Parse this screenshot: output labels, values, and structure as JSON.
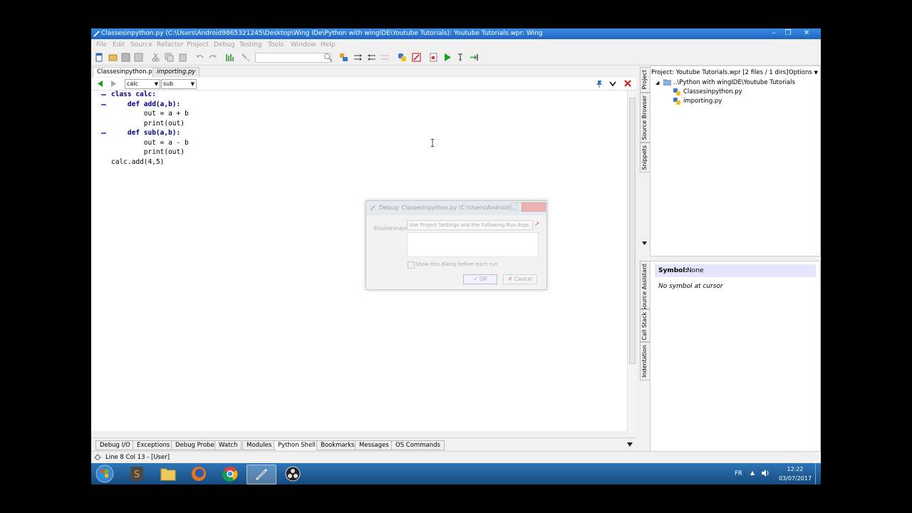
{
  "window": {
    "title": "Classesinpython.py (C:\\Users\\Android9865321245\\Desktop\\Wing IDe\\Python with wingIDE\\Youtube Tutorials): Youtube Tutorials.wpr: Wing"
  },
  "menu": [
    "File",
    "Edit",
    "Source",
    "Refactor",
    "Project",
    "Debug",
    "Testing",
    "Tools",
    "Window",
    "Help"
  ],
  "file_tabs": [
    {
      "label": "Classesinpython.py",
      "active": true
    },
    {
      "label": "importing.py",
      "active": false
    }
  ],
  "editor_bar": {
    "scope1": "calc",
    "scope2": "sub"
  },
  "code_lines": [
    "class calc:",
    "    def add(a,b):",
    "        out = a + b",
    "        print(out)",
    "    def sub(a,b):",
    "        out = a - b",
    "        print(out)",
    "calc.add(4,5)"
  ],
  "bottom_tabs": [
    {
      "label": "Debug I/O",
      "active": false
    },
    {
      "label": "Exceptions",
      "active": false
    },
    {
      "label": "Debug Probe",
      "active": false
    },
    {
      "label": "Watch",
      "active": false
    },
    {
      "label": "Modules",
      "active": false
    },
    {
      "label": "Python Shell",
      "active": true
    },
    {
      "label": "Bookmarks",
      "active": false
    },
    {
      "label": "Messages",
      "active": false
    },
    {
      "label": "OS Commands",
      "active": false
    }
  ],
  "status": {
    "text": "Line 8 Col 13 - [User]"
  },
  "side_tabs_top": [
    "Project",
    "Source Browser",
    "Snippets"
  ],
  "side_tabs_bottom": [
    "Source Assistant",
    "Call Stack",
    "Indentation"
  ],
  "project_panel": {
    "header": "Project: Youtube Tutorials.wpr [2 files / 1 dirs]",
    "options": "Options",
    "folder": "..\\Python with wingIDE\\Youtube Tutorials",
    "files": [
      "Classesinpython.py",
      "importing.py"
    ]
  },
  "source_assistant": {
    "symbol_label": "Symbol:",
    "symbol_value": "None",
    "message": "No symbol at cursor"
  },
  "dialog": {
    "title": "Debug: Classesinpython.py (C:\\Users\\Android9...",
    "env_label": "Environment",
    "env_value": "Use Project Settings and the Following Run Args:",
    "checkbox_label": "Show this dialog before each run",
    "ok": "OK",
    "cancel": "Cancel"
  },
  "taskbar": {
    "lang": "FR",
    "time": "12:22",
    "date": "03/07/2017"
  },
  "colors": {
    "titlebar": "#1e66c0",
    "taskbar": "#1f5e96",
    "code_keyword": "#00008b",
    "code_number": "#008000",
    "highlight": "#ffff80",
    "sas_header": "#e4e4fb"
  }
}
